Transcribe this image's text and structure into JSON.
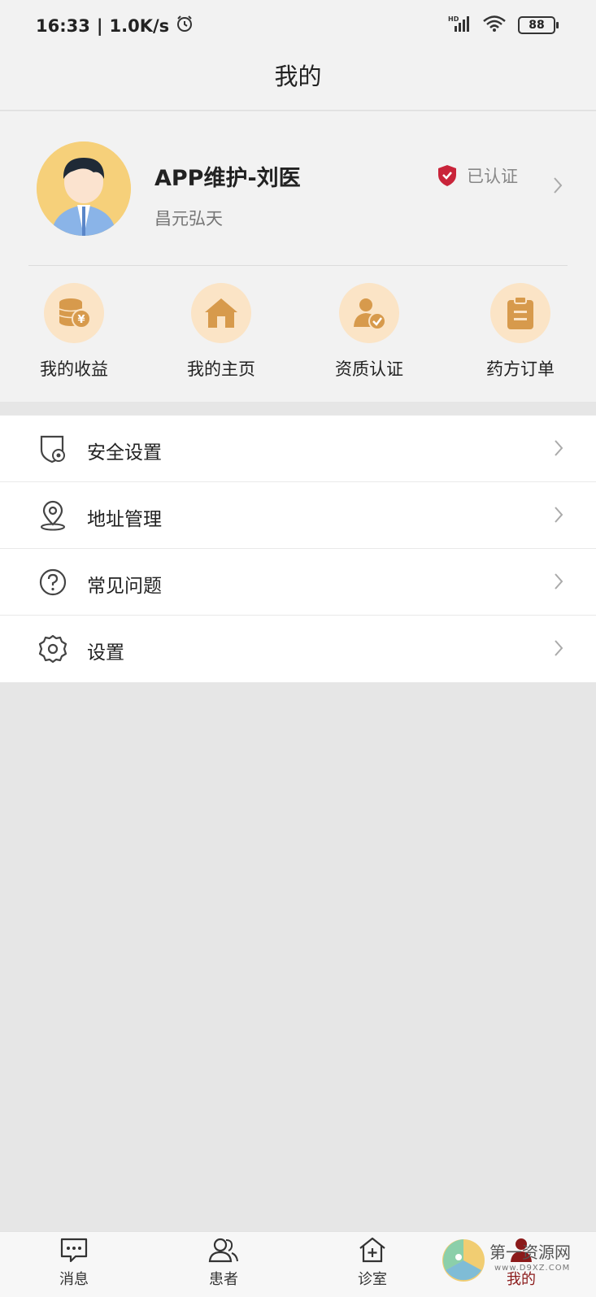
{
  "status_bar": {
    "time": "16:33",
    "network_speed": "1.0K/s",
    "battery": "88",
    "icons": [
      "alarm-icon",
      "signal-icon",
      "wifi-icon",
      "battery-icon"
    ]
  },
  "header": {
    "title": "我的"
  },
  "profile": {
    "name": "APP维护-刘医",
    "organization": "昌元弘天",
    "verified_label": "已认证"
  },
  "quick_actions": [
    {
      "label": "我的收益",
      "icon": "coins-icon"
    },
    {
      "label": "我的主页",
      "icon": "home-icon"
    },
    {
      "label": "资质认证",
      "icon": "user-check-icon"
    },
    {
      "label": "药方订单",
      "icon": "clipboard-icon"
    }
  ],
  "menu": [
    {
      "label": "安全设置",
      "icon": "shield-settings-icon"
    },
    {
      "label": "地址管理",
      "icon": "location-icon"
    },
    {
      "label": "常见问题",
      "icon": "question-icon"
    },
    {
      "label": "设置",
      "icon": "gear-icon"
    }
  ],
  "tabs": [
    {
      "label": "消息",
      "icon": "message-icon"
    },
    {
      "label": "患者",
      "icon": "patients-icon"
    },
    {
      "label": "诊室",
      "icon": "clinic-icon"
    },
    {
      "label": "我的",
      "icon": "person-icon",
      "active": true
    }
  ],
  "watermark": {
    "text": "第一资源网",
    "url": "www.D9XZ.COM"
  },
  "colors": {
    "accent": "#8b1a1a",
    "icon_circle": "#fbe4c6",
    "icon_fill": "#d79a4c",
    "verified_badge": "#c9243a",
    "background": "#e6e6e6"
  }
}
